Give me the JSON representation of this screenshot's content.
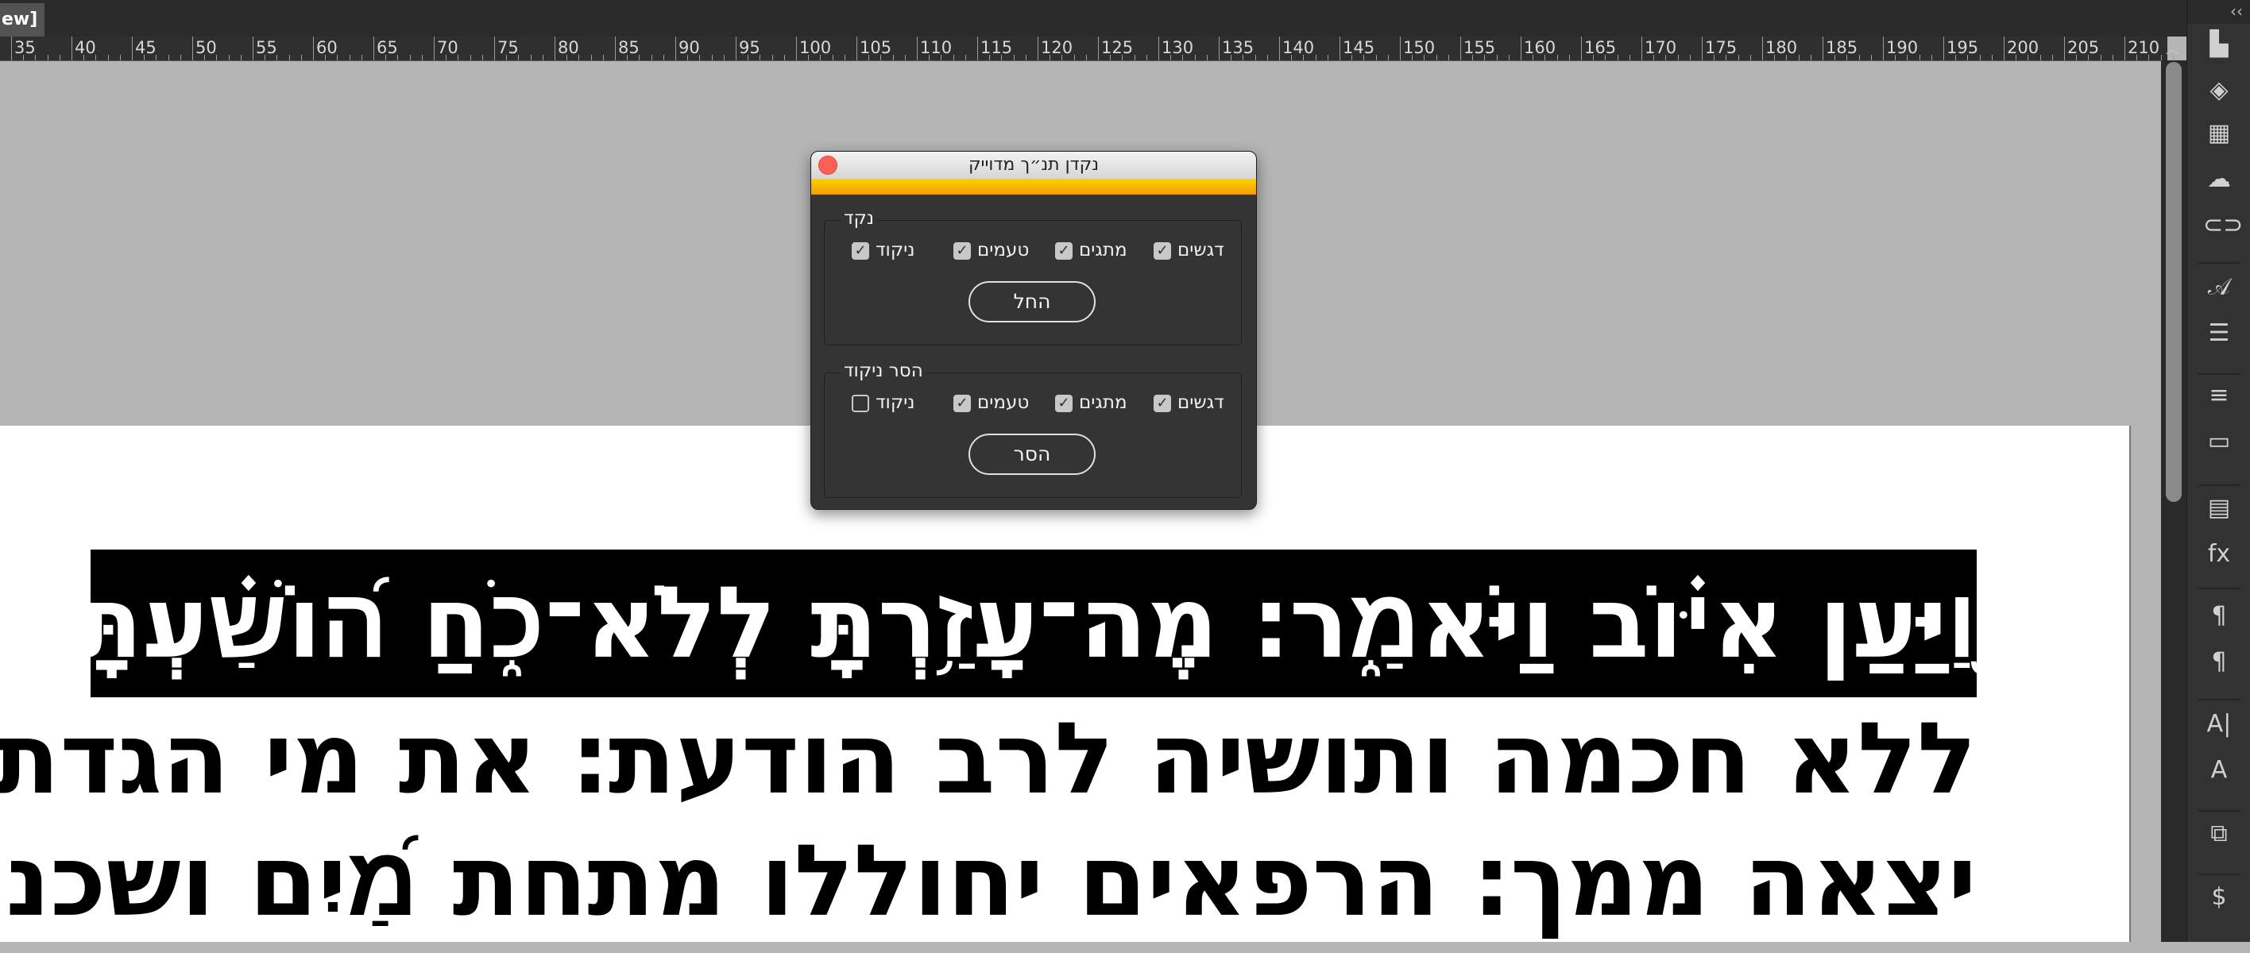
{
  "tabbar": {
    "active_tab": "ew]"
  },
  "ruler": {
    "labels": [
      "35",
      "40",
      "45",
      "50",
      "55",
      "60",
      "65",
      "70",
      "75",
      "80",
      "85",
      "90",
      "95",
      "100",
      "105",
      "110",
      "115",
      "120",
      "125",
      "130",
      "135",
      "140",
      "145",
      "150",
      "155",
      "160",
      "165",
      "170",
      "175",
      "180",
      "185",
      "190",
      "195",
      "200",
      "205",
      "210"
    ]
  },
  "right_panel": {
    "collapse": "‹‹",
    "icons": [
      {
        "name": "pages-icon",
        "glyph": "▙"
      },
      {
        "name": "layers-icon",
        "glyph": "◈"
      },
      {
        "name": "links-grid-icon",
        "glyph": "▦"
      },
      {
        "name": "creative-cloud-icon",
        "glyph": "☁"
      },
      {
        "name": "hyperlinks-icon",
        "glyph": "⊂⊃"
      },
      {
        "name": "glyphs-icon",
        "glyph": "𝒜"
      },
      {
        "name": "text-wrap-icon",
        "glyph": "☰"
      },
      {
        "name": "stroke-icon",
        "glyph": "≡"
      },
      {
        "name": "gradient-icon",
        "glyph": "▭"
      },
      {
        "name": "text-frame-icon",
        "glyph": "▤"
      },
      {
        "name": "effects-icon",
        "glyph": "fx"
      },
      {
        "name": "paragraph-icon",
        "glyph": "¶"
      },
      {
        "name": "paragraph-styles-icon",
        "glyph": "¶"
      },
      {
        "name": "character-icon",
        "glyph": "A|"
      },
      {
        "name": "character-styles-icon",
        "glyph": "A"
      },
      {
        "name": "links-icon",
        "glyph": "⧉"
      },
      {
        "name": "swatches-icon",
        "glyph": "$"
      }
    ]
  },
  "document": {
    "lines": [
      "וַ֭יַּעַן אִיּ֗וֹב וַיֹּאמַ֑ר׃ מֶה־עָזַ֥רְתָּ לְלֹא־כֹ֑חַ ה֝וֹשַׁ֗עְתָּ זְר֣וֹעַ לֹא־עֹֽז׃ מ",
      "ללא חכמה ותושיה לרב הודעת׃ את מי הגדת מלין ונש",
      "יצאה ממך׃ הרפאים יחוללו מתחת מַ֝יִם ושכניהם׃ ערומ"
    ]
  },
  "dialog": {
    "title": "נקדן תנ״ך מדוייק",
    "apply_group": {
      "legend": "נקד",
      "options": [
        {
          "label": "ניקוד",
          "checked": true
        },
        {
          "label": "טעמים",
          "checked": true
        },
        {
          "label": "מתגים",
          "checked": true
        },
        {
          "label": "דגשים",
          "checked": true
        }
      ],
      "button": "החל"
    },
    "remove_group": {
      "legend": "הסר ניקוד",
      "options": [
        {
          "label": "ניקוד",
          "checked": false
        },
        {
          "label": "טעמים",
          "checked": true
        },
        {
          "label": "מתגים",
          "checked": true
        },
        {
          "label": "דגשים",
          "checked": true
        }
      ],
      "button": "הסר"
    }
  }
}
